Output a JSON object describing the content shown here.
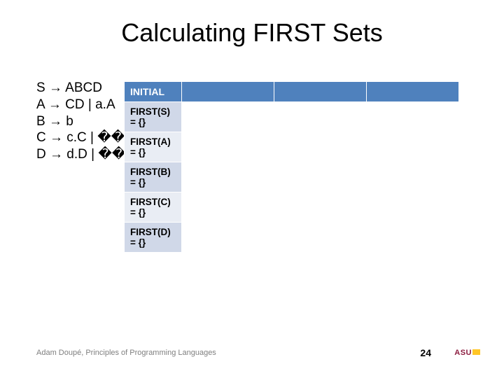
{
  "title": "Calculating FIRST Sets",
  "grammar": {
    "l0": "S → ABCD",
    "l1": "A → CD | a.A",
    "l2": "B → b",
    "l3": "C → c.C | ��",
    "l4": "D → d.D | ��"
  },
  "table": {
    "header": "INITIAL",
    "rows": [
      {
        "label": "FIRST(S)",
        "value": "= {}"
      },
      {
        "label": "FIRST(A)",
        "value": "= {}"
      },
      {
        "label": "FIRST(B)",
        "value": "= {}"
      },
      {
        "label": "FIRST(C)",
        "value": "= {}"
      },
      {
        "label": "FIRST(D)",
        "value": "= {}"
      }
    ]
  },
  "footer": "Adam Doupé, Principles of Programming Languages",
  "page": "24",
  "logo": "ASU"
}
